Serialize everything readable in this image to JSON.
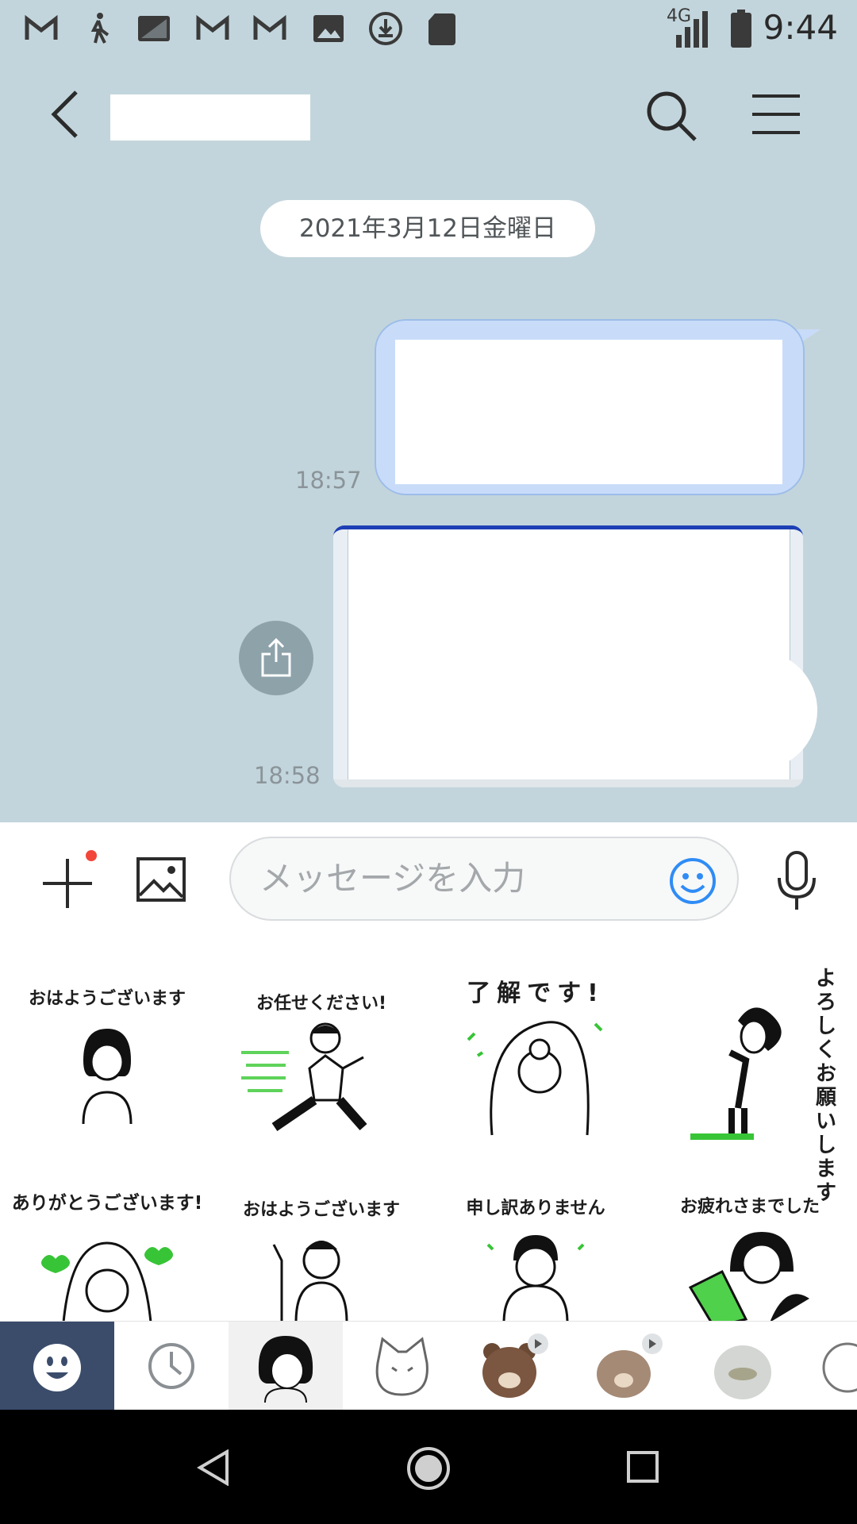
{
  "status_bar": {
    "time": "9:44",
    "network": "4G",
    "icons": [
      "gmail-icon",
      "walk-icon",
      "screenshot-icon",
      "gmail-icon",
      "gmail-icon",
      "image-icon",
      "download-icon",
      "sdcard-icon",
      "signal-icon",
      "battery-icon"
    ]
  },
  "header": {
    "back_icon": "back-icon",
    "search_icon": "search-icon",
    "menu_icon": "menu-icon"
  },
  "chat": {
    "date_label": "2021年3月12日金曜日",
    "messages": [
      {
        "type": "text",
        "time": "18:57"
      },
      {
        "type": "image",
        "time": "18:58"
      }
    ]
  },
  "input_bar": {
    "placeholder": "メッセージを入力",
    "plus_icon": "plus-icon",
    "photo_icon": "photo-icon",
    "emoji_icon": "emoji-icon",
    "mic_icon": "mic-icon"
  },
  "stickers": [
    {
      "label": "おはようございます"
    },
    {
      "label": "お任せください!"
    },
    {
      "label": "了解です!"
    },
    {
      "label": "よろしくお願いします"
    },
    {
      "label": "ありがとうございます!"
    },
    {
      "label": "おはようございます"
    },
    {
      "label": "申し訳ありません"
    },
    {
      "label": "お疲れさまでした"
    }
  ],
  "sticker_tabs": [
    "emoji-tab",
    "recent-tab",
    "women-sticker-tab",
    "cat-sticker-tab",
    "brown-bear-tab",
    "brown-cony-tab",
    "sally-duck-tab",
    "more-tab"
  ],
  "colors": {
    "chat_bg": "#c3d5dc",
    "sent_bubble": "#c8dcf9",
    "accent_blue": "#2f8cf5",
    "notification_red": "#f2463b"
  }
}
